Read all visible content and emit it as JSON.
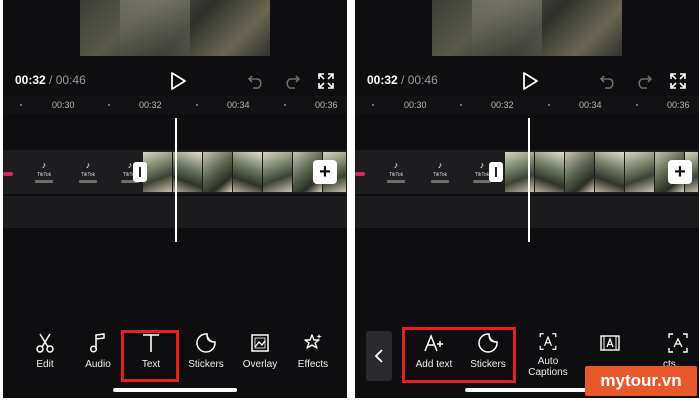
{
  "time": {
    "current": "00:32",
    "separator": "/",
    "total": "00:46"
  },
  "ruler_labels": [
    "00:30",
    "00:32",
    "00:34",
    "00:36"
  ],
  "tiktok_segment": {
    "logo": "♪",
    "word": "TikTok"
  },
  "left_toolbar": {
    "items": [
      {
        "label": "Edit",
        "icon": "scissors-icon"
      },
      {
        "label": "Audio",
        "icon": "music-note-icon"
      },
      {
        "label": "Text",
        "icon": "text-icon"
      },
      {
        "label": "Stickers",
        "icon": "sticker-icon"
      },
      {
        "label": "Overlay",
        "icon": "overlay-icon"
      },
      {
        "label": "Effects",
        "icon": "effects-icon"
      }
    ],
    "highlighted": "Text"
  },
  "right_toolbar": {
    "items": [
      {
        "label": "Add text",
        "icon": "add-text-icon"
      },
      {
        "label": "Stickers",
        "icon": "sticker-icon"
      },
      {
        "label": "Auto\nCaptions",
        "label_line1": "Auto",
        "label_line2": "Captions",
        "icon": "auto-captions-icon"
      },
      {
        "label": "",
        "icon": "text-template-icon"
      },
      {
        "label": "cts",
        "icon": "text-effects-icon"
      }
    ],
    "highlighted": [
      "Add text",
      "Stickers"
    ]
  },
  "watermark": {
    "text": "mytour.vn"
  },
  "colors": {
    "highlight": "#e2231a",
    "background": "#0e0e10",
    "marker": "#e0245e",
    "watermark": "#e8582a"
  }
}
